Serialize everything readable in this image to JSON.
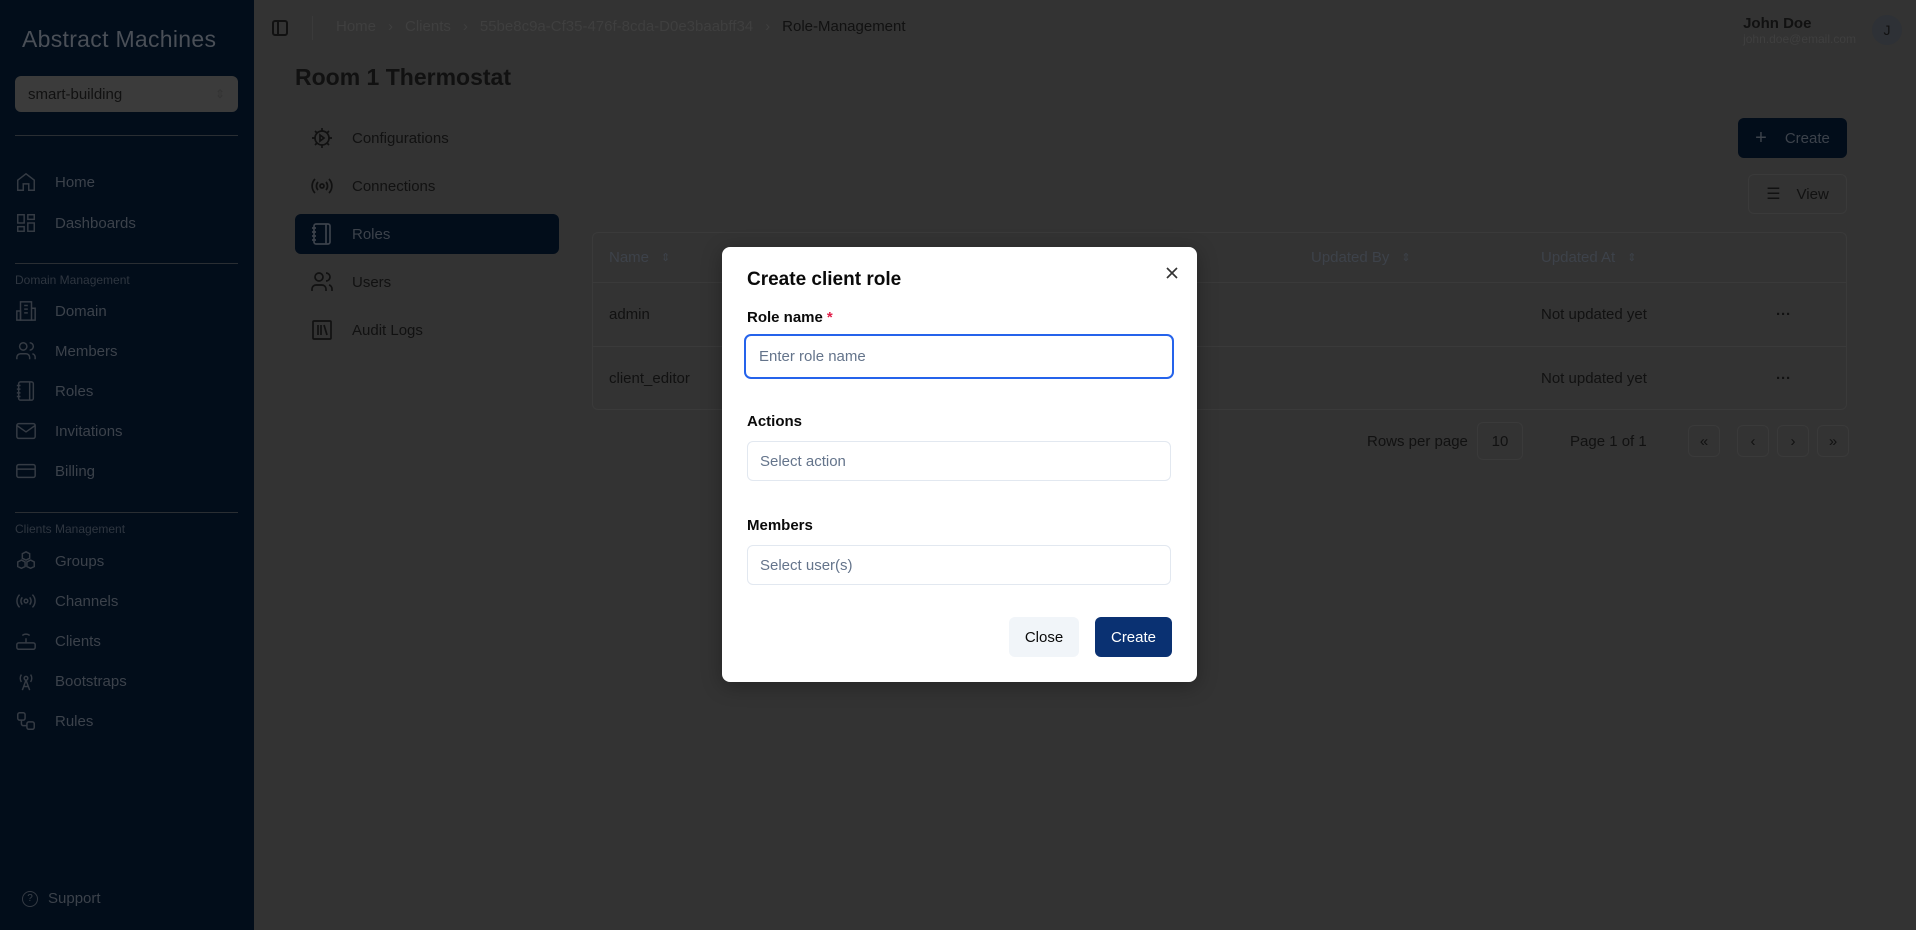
{
  "sidebar": {
    "logo": "Abstract Machines",
    "workspace": "smart-building",
    "top_items": [
      {
        "label": "Home",
        "icon": "home-icon"
      },
      {
        "label": "Dashboards",
        "icon": "dashboard-icon"
      }
    ],
    "domain_section": "Domain Management",
    "domain_items": [
      {
        "label": "Domain",
        "icon": "building-icon"
      },
      {
        "label": "Members",
        "icon": "users-icon"
      },
      {
        "label": "Roles",
        "icon": "notebook-icon"
      },
      {
        "label": "Invitations",
        "icon": "mail-icon"
      },
      {
        "label": "Billing",
        "icon": "credit-card-icon"
      }
    ],
    "clients_section": "Clients Management",
    "clients_items": [
      {
        "label": "Groups",
        "icon": "boxes-icon"
      },
      {
        "label": "Channels",
        "icon": "radio-icon"
      },
      {
        "label": "Clients",
        "icon": "router-icon"
      },
      {
        "label": "Bootstraps",
        "icon": "antenna-icon"
      },
      {
        "label": "Rules",
        "icon": "workflow-icon"
      }
    ],
    "support": "Support"
  },
  "header": {
    "breadcrumbs": [
      "Home",
      "Clients",
      "55be8c9a-Cf35-476f-8cda-D0e3baabff34",
      "Role-Management"
    ],
    "user_name": "John Doe",
    "user_email": "john.doe@email.com",
    "avatar": "J"
  },
  "page": {
    "title": "Room 1 Thermostat",
    "subnav": [
      {
        "label": "Configurations",
        "icon": "settings-icon"
      },
      {
        "label": "Connections",
        "icon": "radio-icon"
      },
      {
        "label": "Roles",
        "icon": "notebook-icon",
        "active": true
      },
      {
        "label": "Users",
        "icon": "users-icon"
      },
      {
        "label": "Audit Logs",
        "icon": "library-icon"
      }
    ],
    "create_label": "Create",
    "view_label": "View",
    "table": {
      "columns": [
        "Name",
        "Updated By",
        "Updated At"
      ],
      "rows": [
        {
          "name": "admin",
          "updated_by": "",
          "updated_at": "Not updated yet"
        },
        {
          "name": "client_editor",
          "updated_by": "",
          "updated_at": "Not updated yet"
        }
      ]
    },
    "pagination": {
      "rows_per_page_label": "Rows per page",
      "rows_per_page": "10",
      "page_text": "Page 1 of 1",
      "first": "«",
      "prev": "‹",
      "next": "›",
      "last": "»"
    }
  },
  "modal": {
    "title": "Create client role",
    "role_label": "Role name",
    "required": "*",
    "role_placeholder": "Enter role name",
    "actions_label": "Actions",
    "actions_placeholder": "Select action",
    "members_label": "Members",
    "members_placeholder": "Select user(s)",
    "close_label": "Close",
    "create_label": "Create"
  },
  "colors": {
    "primary": "#0a3172",
    "focus": "#2563eb",
    "required": "#e11d48"
  }
}
